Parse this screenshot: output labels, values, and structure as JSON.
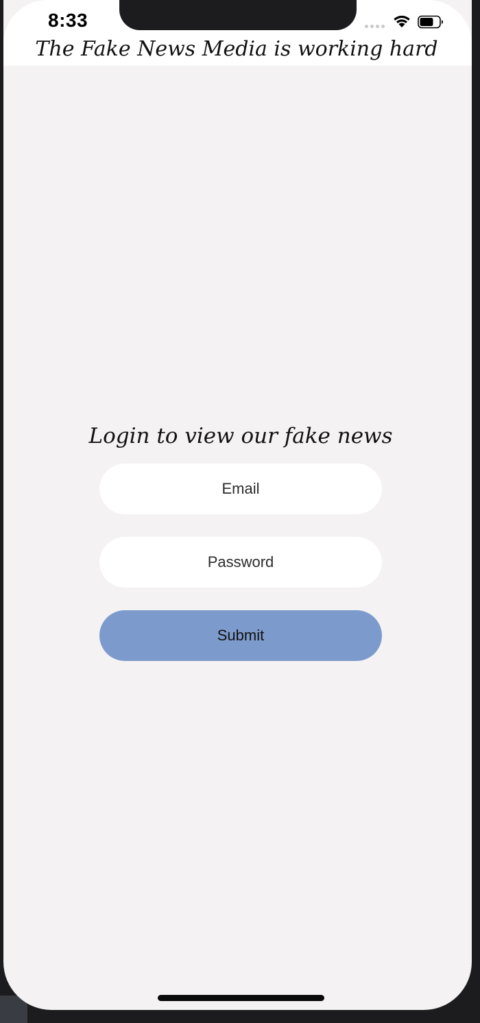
{
  "status_bar": {
    "time": "8:33",
    "wifi_icon": "wifi-icon",
    "battery_icon": "battery-icon",
    "signal_icon": "cellular-signal-icon"
  },
  "header": {
    "tagline": "The Fake News Media is working hard"
  },
  "login": {
    "title": "Login to view our fake news",
    "email_placeholder": "Email",
    "password_placeholder": "Password",
    "submit_label": "Submit"
  },
  "colors": {
    "background": "#f4f2f2",
    "header_background": "#ffffff",
    "button": "#7c9bcc",
    "field": "#ffffff"
  }
}
